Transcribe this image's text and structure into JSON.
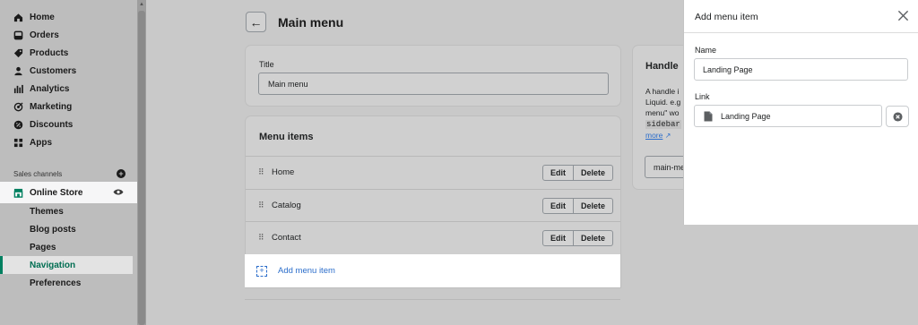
{
  "sidebar": {
    "items": [
      {
        "label": "Home",
        "icon": "home-icon"
      },
      {
        "label": "Orders",
        "icon": "orders-icon"
      },
      {
        "label": "Products",
        "icon": "tag-icon"
      },
      {
        "label": "Customers",
        "icon": "person-icon"
      },
      {
        "label": "Analytics",
        "icon": "bar-chart-icon"
      },
      {
        "label": "Marketing",
        "icon": "target-icon"
      },
      {
        "label": "Discounts",
        "icon": "discount-icon"
      },
      {
        "label": "Apps",
        "icon": "apps-icon"
      }
    ],
    "sales_channels_label": "Sales channels",
    "online_store_label": "Online Store",
    "sub_items": [
      "Themes",
      "Blog posts",
      "Pages",
      "Navigation",
      "Preferences"
    ],
    "active_sub_item": "Navigation"
  },
  "page": {
    "title": "Main menu"
  },
  "title_card": {
    "label": "Title",
    "value": "Main menu"
  },
  "menu_card": {
    "heading": "Menu items",
    "edit_label": "Edit",
    "delete_label": "Delete",
    "items": [
      "Home",
      "Catalog",
      "Contact"
    ],
    "add_label": "Add menu item"
  },
  "handle_card": {
    "heading": "Handle",
    "line1": "A handle i",
    "line2": "Liquid. e.g",
    "line3": "menu\" wo",
    "code": "sidebar",
    "more": "more",
    "value": "main-menu"
  },
  "panel": {
    "title": "Add menu item",
    "name_label": "Name",
    "name_value": "Landing Page",
    "link_label": "Link",
    "link_value": "Landing Page"
  },
  "colors": {
    "accent_green": "#008060",
    "link_blue": "#2c6ecb"
  }
}
